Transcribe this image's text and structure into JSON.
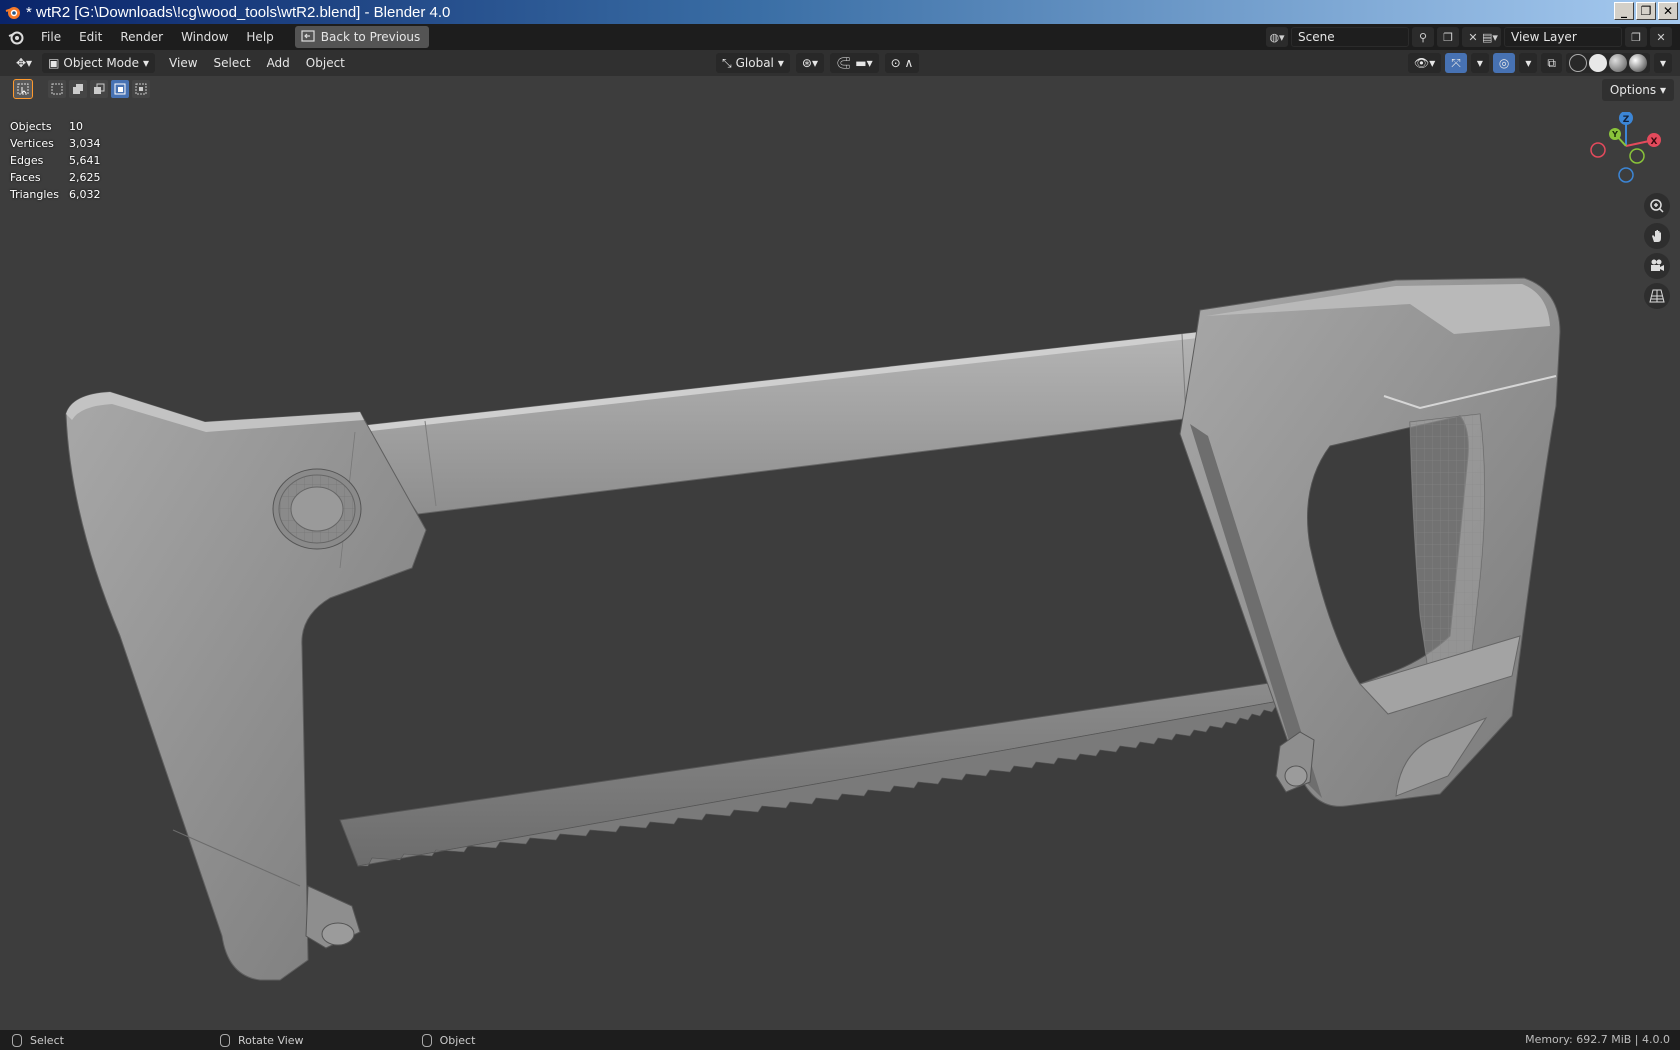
{
  "window": {
    "title": "* wtR2 [G:\\Downloads\\!cg\\wood_tools\\wtR2.blend] - Blender 4.0",
    "buttons": {
      "minimize": "_",
      "restore": "❐",
      "close": "✕"
    }
  },
  "menubar": {
    "items": [
      "File",
      "Edit",
      "Render",
      "Window",
      "Help"
    ],
    "back_button": "Back to Previous",
    "scene": "Scene",
    "view_layer": "View Layer"
  },
  "viewport_header": {
    "mode": "Object Mode",
    "menus": [
      "View",
      "Select",
      "Add",
      "Object"
    ],
    "orientation": "Global"
  },
  "stats": [
    {
      "label": "Objects",
      "value": "10"
    },
    {
      "label": "Vertices",
      "value": "3,034"
    },
    {
      "label": "Edges",
      "value": "5,641"
    },
    {
      "label": "Faces",
      "value": "2,625"
    },
    {
      "label": "Triangles",
      "value": "6,032"
    }
  ],
  "options_label": "Options",
  "gizmo": {
    "x": "X",
    "y": "Y",
    "z": "Z"
  },
  "statusbar": {
    "select": "Select",
    "rotate": "Rotate View",
    "object": "Object",
    "memory": "Memory: 692.7 MiB | 4.0.0"
  },
  "colors": {
    "x_axis": "#e44a5c",
    "y_axis": "#8ac43a",
    "z_axis": "#3c86d6",
    "accent": "#4772b3"
  }
}
